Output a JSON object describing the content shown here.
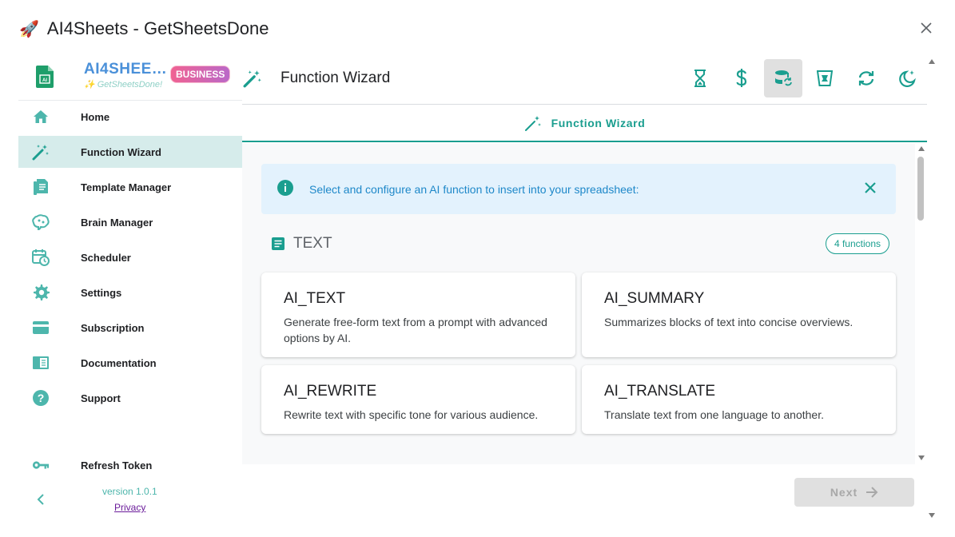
{
  "window": {
    "title": "AI4Sheets - GetSheetsDone",
    "title_icon": "rocket-icon",
    "close_icon": "close-icon"
  },
  "brand": {
    "name": "AI4SHEE…",
    "tagline": "✨ GetSheetsDone!",
    "badge": "BUSINESS"
  },
  "sidebar": {
    "items": [
      {
        "label": "Home",
        "icon": "home-icon"
      },
      {
        "label": "Function Wizard",
        "icon": "magic-wand-icon",
        "active": true
      },
      {
        "label": "Template Manager",
        "icon": "document-icon"
      },
      {
        "label": "Brain Manager",
        "icon": "brain-icon"
      },
      {
        "label": "Scheduler",
        "icon": "calendar-clock-icon"
      },
      {
        "label": "Settings",
        "icon": "gear-icon"
      },
      {
        "label": "Subscription",
        "icon": "credit-card-icon"
      },
      {
        "label": "Documentation",
        "icon": "book-icon"
      },
      {
        "label": "Support",
        "icon": "help-icon"
      }
    ],
    "refresh_label": "Refresh Token",
    "version": "version 1.0.1",
    "privacy": "Privacy"
  },
  "header": {
    "title": "Function Wizard",
    "toolbar": [
      "hourglass-icon",
      "dollar-icon",
      "database-sync-icon",
      "trash-bin-icon",
      "sync-icon",
      "dark-mode-icon"
    ],
    "active_tool": "database-sync-icon"
  },
  "subtab": {
    "label": "Function Wizard"
  },
  "alert": {
    "text": "Select and configure an AI function to insert into your spreadsheet:"
  },
  "section": {
    "title": "TEXT",
    "count": "4 functions"
  },
  "functions": [
    {
      "name": "AI_TEXT",
      "description": "Generate free-form text from a prompt with advanced options by AI."
    },
    {
      "name": "AI_SUMMARY",
      "description": "Summarizes blocks of text into concise overviews."
    },
    {
      "name": "AI_REWRITE",
      "description": "Rewrite text with specific tone for various audience."
    },
    {
      "name": "AI_TRANSLATE",
      "description": "Translate text from one language to another."
    }
  ],
  "footer": {
    "next_label": "Next"
  },
  "colors": {
    "accent": "#1a9e8f",
    "sidebar_active": "#d6eceb",
    "alert_bg": "#e3f2fd",
    "alert_text": "#1e88c9"
  }
}
